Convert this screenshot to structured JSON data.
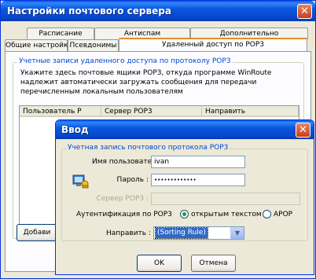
{
  "window": {
    "title": "Настройки почтового сервера",
    "close_glyph": "✕"
  },
  "tabs_row1": [
    {
      "label": "Расписание"
    },
    {
      "label": "Антиспам"
    },
    {
      "label": "Дополнительно"
    }
  ],
  "tabs_row2": [
    {
      "label": "Общие настройки"
    },
    {
      "label": "Псевдонимы"
    },
    {
      "label": "Удаленный доступ по POP3"
    }
  ],
  "panel": {
    "group_title": "Учетные записи удаленного доступа по протоколу POP3",
    "description_lines": [
      "Укажите здесь почтовые ящики POP3, откуда программе WinRoute",
      "надлежит автоматически загружать сообщения для передачи",
      "перечисленным локальным пользователям"
    ],
    "columns": [
      "Пользователь P",
      "Сервер POP3",
      "Направить"
    ],
    "add_button": "Добави"
  },
  "dialog": {
    "title": "Ввод",
    "close_glyph": "✕",
    "group_title": "Учетная запись почтового протокола POP3",
    "username_label": "Имя пользователя :",
    "username_value": "ivan",
    "password_label": "Пароль :",
    "password_value": "•••••••••••••",
    "server_label": "Сервер POP3 :",
    "server_value": "",
    "auth_label": "Аутентификация по POP3",
    "auth_option1": "открытым текстом",
    "auth_option2": "APOP",
    "forward_label": "Направить :",
    "forward_value": "(Sorting Rule)",
    "ok_button": "OK",
    "cancel_button": "Отмена"
  }
}
